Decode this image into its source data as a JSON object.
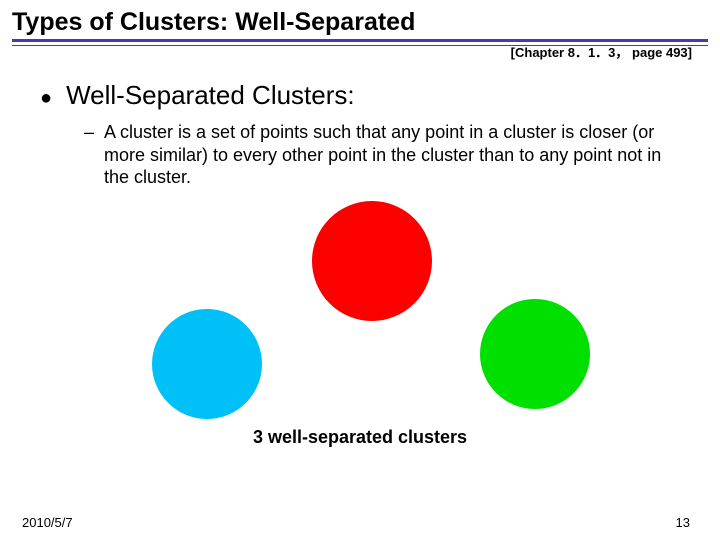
{
  "title": "Types of Clusters: Well-Separated",
  "chapter_ref": "[Chapter 8．1．3， page 493]",
  "bullet": {
    "label": "Well-Separated Clusters:",
    "sub": "A cluster is a set of points such that any point in a cluster is closer (or more similar) to every other point in the cluster than to any point not in the cluster."
  },
  "caption": "3 well-separated clusters",
  "footer": {
    "date": "2010/5/7",
    "page": "13"
  },
  "clusters": {
    "red": "#fc0000",
    "cyan": "#00c0f8",
    "green": "#00e000"
  }
}
